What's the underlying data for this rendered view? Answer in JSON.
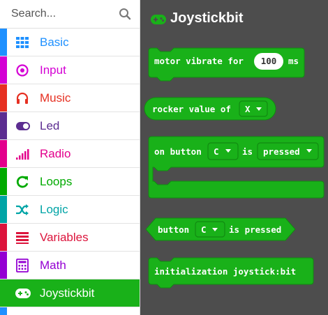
{
  "search": {
    "placeholder": "Search..."
  },
  "categories": [
    {
      "label": "Basic",
      "color": "#1e90ff"
    },
    {
      "label": "Input",
      "color": "#d400d4"
    },
    {
      "label": "Music",
      "color": "#e63022"
    },
    {
      "label": "Led",
      "color": "#5c2d91"
    },
    {
      "label": "Radio",
      "color": "#e3008c"
    },
    {
      "label": "Loops",
      "color": "#00aa00"
    },
    {
      "label": "Logic",
      "color": "#00a4a6"
    },
    {
      "label": "Variables",
      "color": "#dc143c"
    },
    {
      "label": "Math",
      "color": "#9400d3"
    },
    {
      "label": "Joystickbit",
      "color": "#19b119",
      "selected": true
    }
  ],
  "workspace": {
    "title": "Joystickbit",
    "accent": "#19b119",
    "blocks": {
      "motor": {
        "label": "motor vibrate for",
        "value": "100",
        "unit": "ms"
      },
      "rocker": {
        "label": "rocker value of",
        "option": "X"
      },
      "on_button": {
        "label": "on button",
        "button": "C",
        "is_label": "is",
        "state": "pressed"
      },
      "button_pressed": {
        "label": "button",
        "button": "C",
        "suffix": "is pressed"
      },
      "init": {
        "label": "initialization joystick:bit"
      }
    }
  }
}
